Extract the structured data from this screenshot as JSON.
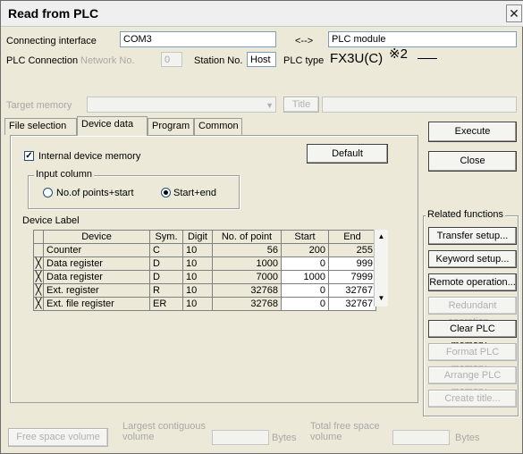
{
  "window": {
    "title": "Read from PLC",
    "close_glyph": "✕"
  },
  "connection": {
    "interface_label": "Connecting interface",
    "interface_value": "COM3",
    "arrow": "<-->",
    "target_value": "PLC module",
    "plc_connection_label": "PLC Connection",
    "network_no_label": "Network No.",
    "network_no_value": "0",
    "station_no_label": "Station No.",
    "station_no_value": "Host",
    "plc_type_label": "PLC type",
    "plc_type_value": "FX3U(C)",
    "plc_type_note": "※2"
  },
  "target_memory": {
    "label": "Target memory",
    "title_button": "Title"
  },
  "tabs": [
    {
      "label": "File selection",
      "active": false
    },
    {
      "label": "Device data",
      "active": true
    },
    {
      "label": "Program",
      "active": false
    },
    {
      "label": "Common",
      "active": false
    }
  ],
  "device_panel": {
    "internal_memory_label": "Internal device memory",
    "internal_memory_checked": true,
    "default_button": "Default",
    "input_column_caption": "Input column",
    "radio_points": "No.of points+start",
    "radio_startend": "Start+end",
    "device_label": "Device Label"
  },
  "table": {
    "headers": [
      "Device",
      "Sym.",
      "Digit",
      "No. of point",
      "Start",
      "End"
    ],
    "rows": [
      {
        "mark": "",
        "device": "Counter",
        "sym": "C",
        "digit": "10",
        "points": "56",
        "start": "200",
        "end": "255"
      },
      {
        "mark": "╳",
        "device": "Data register",
        "sym": "D",
        "digit": "10",
        "points": "1000",
        "start": "0",
        "end": "999"
      },
      {
        "mark": "╳",
        "device": "Data register",
        "sym": "D",
        "digit": "10",
        "points": "7000",
        "start": "1000",
        "end": "7999"
      },
      {
        "mark": "╳",
        "device": "Ext. register",
        "sym": "R",
        "digit": "10",
        "points": "32768",
        "start": "0",
        "end": "32767"
      },
      {
        "mark": "╳",
        "device": "Ext. file register",
        "sym": "ER",
        "digit": "10",
        "points": "32768",
        "start": "0",
        "end": "32767"
      }
    ]
  },
  "actions": {
    "execute": "Execute",
    "close": "Close"
  },
  "related": {
    "caption": "Related functions",
    "buttons": [
      {
        "label": "Transfer setup...",
        "enabled": true
      },
      {
        "label": "Keyword setup...",
        "enabled": true
      },
      {
        "label": "Remote operation...",
        "enabled": true
      },
      {
        "label": "Redundant operation...",
        "enabled": false
      },
      {
        "label": "Clear PLC memory...",
        "enabled": true
      },
      {
        "label": "Format PLC memory...",
        "enabled": false
      },
      {
        "label": "Arrange PLC memory...",
        "enabled": false
      },
      {
        "label": "Create title...",
        "enabled": false
      }
    ]
  },
  "footer": {
    "free_space_button": "Free space volume",
    "largest_line1": "Largest contiguous",
    "largest_line2": "volume",
    "bytes1": "Bytes",
    "total_line1": "Total free space",
    "total_line2": "volume",
    "bytes2": "Bytes"
  }
}
